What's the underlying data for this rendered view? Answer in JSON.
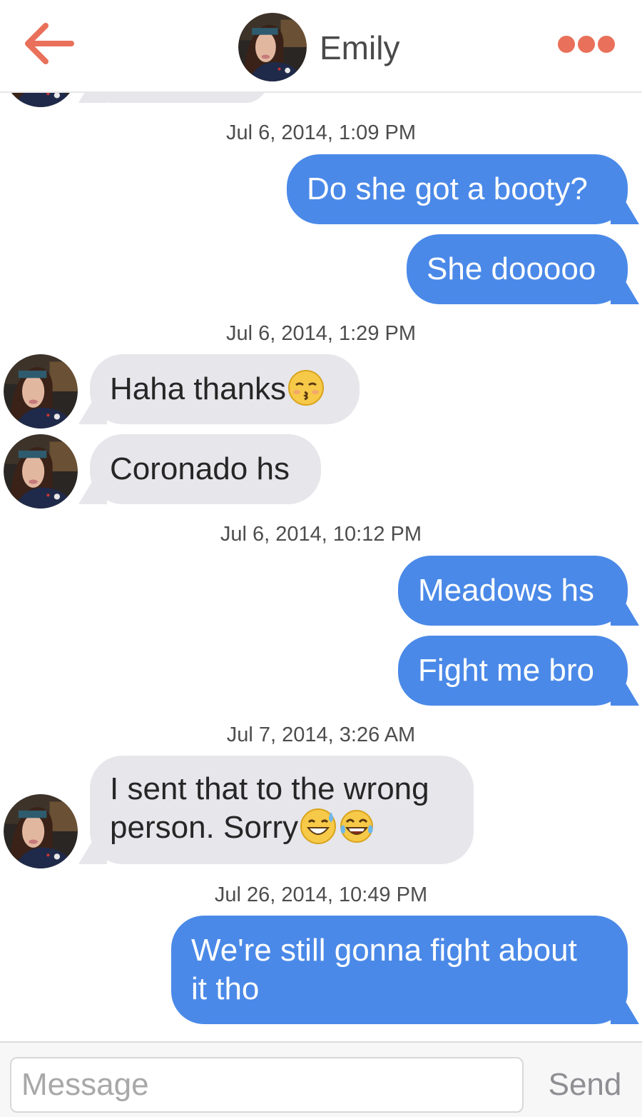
{
  "header": {
    "back_icon": "arrow-left-icon",
    "contact_name": "Emily",
    "more_icon": "more-dots-icon",
    "accent_color": "#e9705a"
  },
  "conversation": [
    {
      "type": "timestamp",
      "text": "Jul 6, 2014, 1:09 PM"
    },
    {
      "type": "outgoing",
      "text": "Do she got a booty?"
    },
    {
      "type": "outgoing",
      "text": "She dooooo"
    },
    {
      "type": "timestamp",
      "text": "Jul 6, 2014, 1:29 PM"
    },
    {
      "type": "incoming",
      "text": "Haha thanks",
      "emoji": [
        "kissing-face-closed-eyes-emoji"
      ]
    },
    {
      "type": "incoming",
      "text": "Coronado hs"
    },
    {
      "type": "timestamp",
      "text": "Jul 6, 2014, 10:12 PM"
    },
    {
      "type": "outgoing",
      "text": "Meadows hs"
    },
    {
      "type": "outgoing",
      "text": "Fight me bro"
    },
    {
      "type": "timestamp",
      "text": "Jul 7, 2014, 3:26 AM"
    },
    {
      "type": "incoming",
      "line1": "I sent that to the wrong",
      "line2": "person. Sorry",
      "emoji": [
        "grinning-sweat-emoji",
        "tears-of-joy-emoji"
      ]
    },
    {
      "type": "timestamp",
      "text": "Jul 26, 2014, 10:49 PM"
    },
    {
      "type": "outgoing",
      "line1": "We're still gonna fight about",
      "line2": "it tho"
    }
  ],
  "composer": {
    "placeholder": "Message",
    "value": "",
    "send_label": "Send"
  },
  "colors": {
    "outgoing_bubble": "#4a89e8",
    "incoming_bubble": "#e6e6eb"
  }
}
